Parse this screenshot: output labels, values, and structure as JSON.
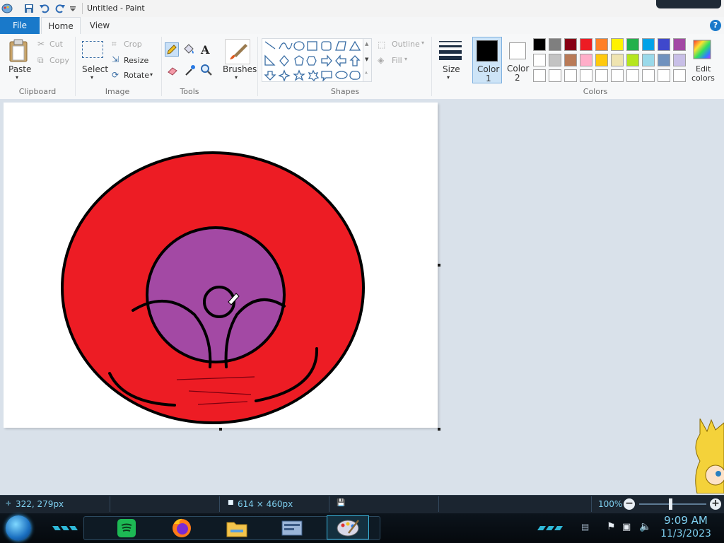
{
  "window": {
    "title": "Untitled - Paint"
  },
  "tabs": {
    "file": "File",
    "home": "Home",
    "view": "View"
  },
  "clipboard": {
    "paste": "Paste",
    "cut": "Cut",
    "copy": "Copy",
    "group": "Clipboard"
  },
  "image": {
    "select": "Select",
    "crop": "Crop",
    "resize": "Resize",
    "rotate": "Rotate",
    "group": "Image"
  },
  "tools": {
    "group": "Tools",
    "text_glyph": "A"
  },
  "brushes": {
    "label": "Brushes"
  },
  "shapes": {
    "outline": "Outline",
    "fill": "Fill",
    "group": "Shapes"
  },
  "size": {
    "label": "Size"
  },
  "color1": {
    "line1": "Color",
    "line2": "1",
    "value": "#000000"
  },
  "color2": {
    "line1": "Color",
    "line2": "2",
    "value": "#ffffff"
  },
  "colors": {
    "group": "Colors",
    "row1": [
      "#000000",
      "#7f7f7f",
      "#880015",
      "#ed1c24",
      "#ff7f27",
      "#fff200",
      "#22b14c",
      "#00a2e8",
      "#3f48cc",
      "#a349a4"
    ],
    "row2": [
      "#ffffff",
      "#c3c3c3",
      "#b97a57",
      "#ffaec9",
      "#ffc90e",
      "#efe4b0",
      "#b5e61d",
      "#99d9ea",
      "#7092be",
      "#c8bfe7"
    ],
    "row3": [
      "#ffffff",
      "#ffffff",
      "#ffffff",
      "#ffffff",
      "#ffffff",
      "#ffffff",
      "#ffffff",
      "#ffffff",
      "#ffffff",
      "#ffffff"
    ],
    "edit_line1": "Edit",
    "edit_line2": "colors"
  },
  "drawing": {
    "outer_fill": "#ed1c24",
    "inner_fill": "#a349a4",
    "stroke": "#000000"
  },
  "status": {
    "cursor": "322, 279px",
    "dimensions": "614 × 460px",
    "zoom": "100%"
  },
  "taskbar": {
    "time": "9:09 AM",
    "date": "11/3/2023"
  }
}
